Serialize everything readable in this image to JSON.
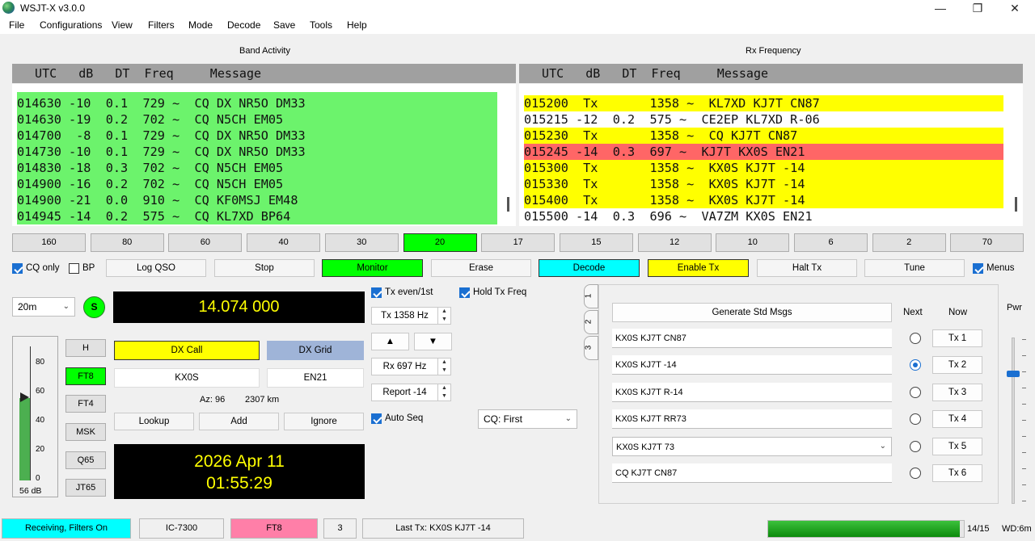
{
  "app": {
    "title": "WSJT-X   v3.0.0"
  },
  "window": {
    "minimize": "—",
    "maximize": "❐",
    "close": "✕"
  },
  "menu": [
    "File",
    "Configurations",
    "View",
    "Filters",
    "Mode",
    "Decode",
    "Save",
    "Tools",
    "Help"
  ],
  "band_activity": {
    "label": "Band Activity",
    "header": "  UTC   dB   DT  Freq     Message",
    "rows": [
      "014630 -10  0.1  729 ~  CQ DX NR5O DM33",
      "014630 -19  0.2  702 ~  CQ N5CH EM05",
      "014700  -8  0.1  729 ~  CQ DX NR5O DM33",
      "014730 -10  0.1  729 ~  CQ DX NR5O DM33",
      "014830 -18  0.3  702 ~  CQ N5CH EM05",
      "014900 -16  0.2  702 ~  CQ N5CH EM05",
      "014900 -21  0.0  910 ~  CQ KF0MSJ EM48",
      "014945 -14  0.2  575 ~  CQ KL7XD BP64"
    ],
    "row_color": "#6cf36c"
  },
  "rx_frequency": {
    "label": "Rx Frequency",
    "header": "  UTC   dB   DT  Freq     Message",
    "rows": [
      {
        "text": "015200  Tx       1358 ~  KL7XD KJ7T CN87",
        "color": "#ffff00"
      },
      {
        "text": "015215 -12  0.2  575 ~  CE2EP KL7XD R-06",
        "color": "#ffffff"
      },
      {
        "text": "015230  Tx       1358 ~  CQ KJ7T CN87",
        "color": "#ffff00"
      },
      {
        "text": "015245 -14  0.3  697 ~  KJ7T KX0S EN21",
        "color": "#ff6666"
      },
      {
        "text": "015300  Tx       1358 ~  KX0S KJ7T -14",
        "color": "#ffff00"
      },
      {
        "text": "015330  Tx       1358 ~  KX0S KJ7T -14",
        "color": "#ffff00"
      },
      {
        "text": "015400  Tx       1358 ~  KX0S KJ7T -14",
        "color": "#ffff00"
      },
      {
        "text": "015500 -14  0.3  696 ~  VA7ZM KX0S EN21",
        "color": "#ffffff"
      }
    ]
  },
  "bands": {
    "items": [
      "160",
      "80",
      "60",
      "40",
      "30",
      "20",
      "17",
      "15",
      "12",
      "10",
      "6",
      "2",
      "70"
    ],
    "selected": "20"
  },
  "controls": {
    "cq_only": "CQ only",
    "bp": "BP",
    "log_qso": "Log QSO",
    "stop": "Stop",
    "monitor": "Monitor",
    "erase": "Erase",
    "decode": "Decode",
    "enable_tx": "Enable Tx",
    "halt_tx": "Halt Tx",
    "tune": "Tune",
    "menus": "Menus"
  },
  "band_select": "20m",
  "s_meter_button": "S",
  "frequency": "14.074 000",
  "level": {
    "ticks": [
      "80",
      "60",
      "40",
      "20",
      "0"
    ],
    "value_db": "56 dB",
    "fraction": 0.64
  },
  "modes": [
    "H",
    "FT8",
    "FT4",
    "MSK",
    "Q65",
    "JT65"
  ],
  "selected_mode": "FT8",
  "dx": {
    "call_label": "DX Call",
    "grid_label": "DX Grid",
    "call": "KX0S",
    "grid": "EN21",
    "az": "Az: 96",
    "dist": "2307 km"
  },
  "dx_buttons": {
    "lookup": "Lookup",
    "add": "Add",
    "ignore": "Ignore"
  },
  "clock": {
    "date": "2026 Apr 11",
    "time": "01:55:29"
  },
  "tx_settings": {
    "tx_even": "Tx even/1st",
    "hold_tx": "Hold Tx Freq",
    "tx_hz": "Tx  1358  Hz",
    "rx_hz": "Rx  697  Hz",
    "report": "Report -14",
    "auto_seq": "Auto Seq",
    "cq_select": "CQ: First"
  },
  "arrows": {
    "up": "▲",
    "down": "▼"
  },
  "tabs": [
    "1",
    "2",
    "3"
  ],
  "messages": {
    "generate": "Generate Std Msgs",
    "next": "Next",
    "now": "Now",
    "items": [
      "KX0S KJ7T CN87",
      "KX0S KJ7T -14",
      "KX0S KJ7T R-14",
      "KX0S KJ7T RR73",
      "KX0S KJ7T 73",
      "CQ KJ7T CN87"
    ],
    "tx_labels": [
      "Tx 1",
      "Tx 2",
      "Tx 3",
      "Tx 4",
      "Tx 5",
      "Tx 6"
    ],
    "next_selected": 2
  },
  "pwr": {
    "label": "Pwr",
    "level": 0.78
  },
  "status": {
    "receiving": "Receiving, Filters On",
    "rig": "IC-7300",
    "mode": "FT8",
    "count": "3",
    "last_tx": "Last Tx: KX0S KJ7T -14",
    "progress": 0.98,
    "period": "14/15",
    "wd": "WD:6m"
  },
  "colors": {
    "green": "#00ff00",
    "cyan": "#00ffff",
    "yellow": "#ffff00",
    "pink": "#ff7fa8",
    "dx_grid": "#9fb4d8",
    "clock_text": "#ffff00"
  }
}
